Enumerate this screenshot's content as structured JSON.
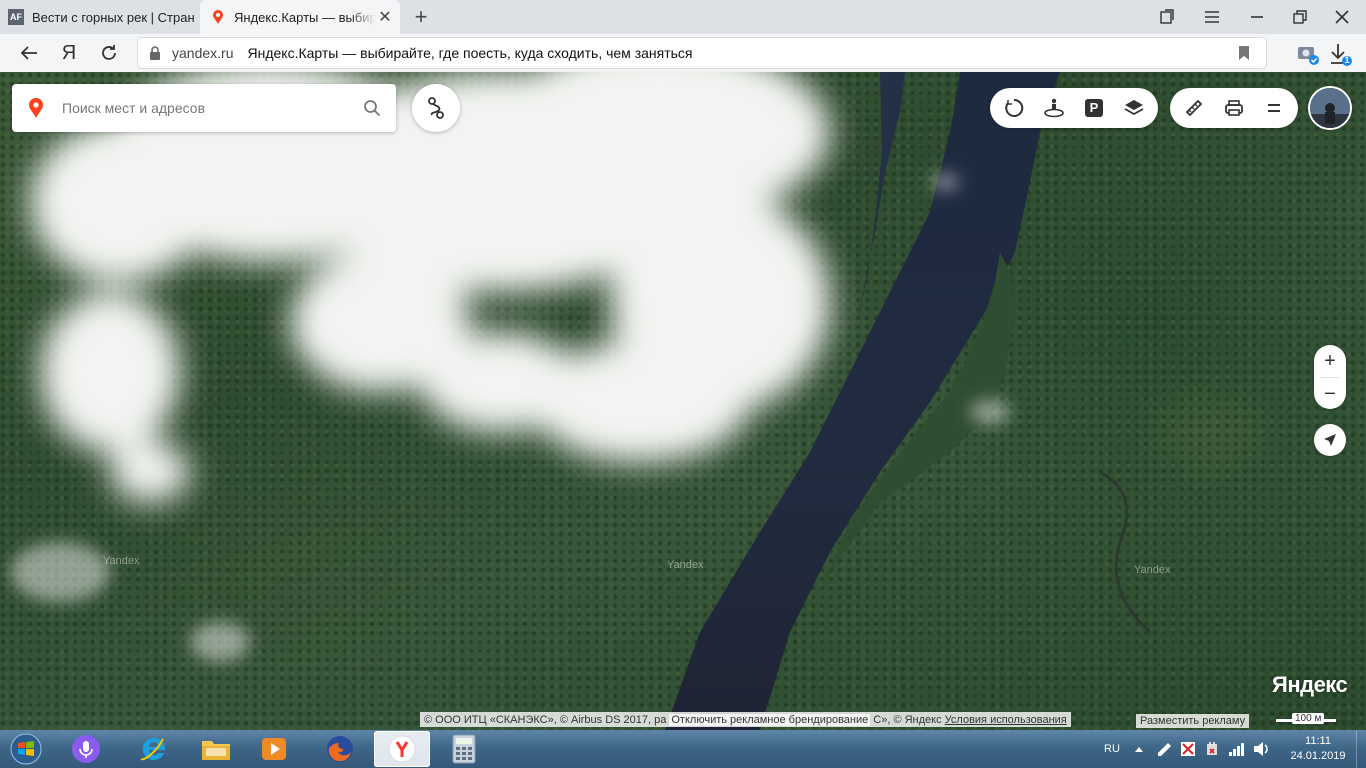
{
  "browser": {
    "tabs": [
      {
        "label": "Вести с горных рек | Стран",
        "favicon": "AF",
        "active": false
      },
      {
        "label": "Яндекс.Карты — выбирайте",
        "favicon": "yandex-maps-pin-icon",
        "active": true
      }
    ],
    "new_tab_label": "+",
    "address": {
      "domain": "yandex.ru",
      "page_title": "Яндекс.Карты — выбирайте, где поесть, куда сходить, чем заняться"
    },
    "yandex_button_label": "Я",
    "downloads_badge": "1"
  },
  "map": {
    "search_placeholder": "Поиск мест и адресов",
    "watermarks": [
      "Yandex",
      "Yandex",
      "Yandex"
    ],
    "zoom_in_label": "+",
    "zoom_out_label": "−",
    "logo": "Яндекс",
    "copyright_text": "© ООО ИТЦ «СКАНЭКС», © Airbus DS 2017, ра",
    "ad_branding_label": "Отключить рекламное брендирование",
    "copyright_text2": "С», © Яндекс",
    "terms_link": "Условия использования",
    "advertise_label": "Разместить рекламу",
    "scale_label": "100 м",
    "parking_label": "P",
    "accent_color": "#fc3f1d"
  },
  "taskbar": {
    "language": "RU",
    "time": "11:11",
    "date": "24.01.2019"
  }
}
